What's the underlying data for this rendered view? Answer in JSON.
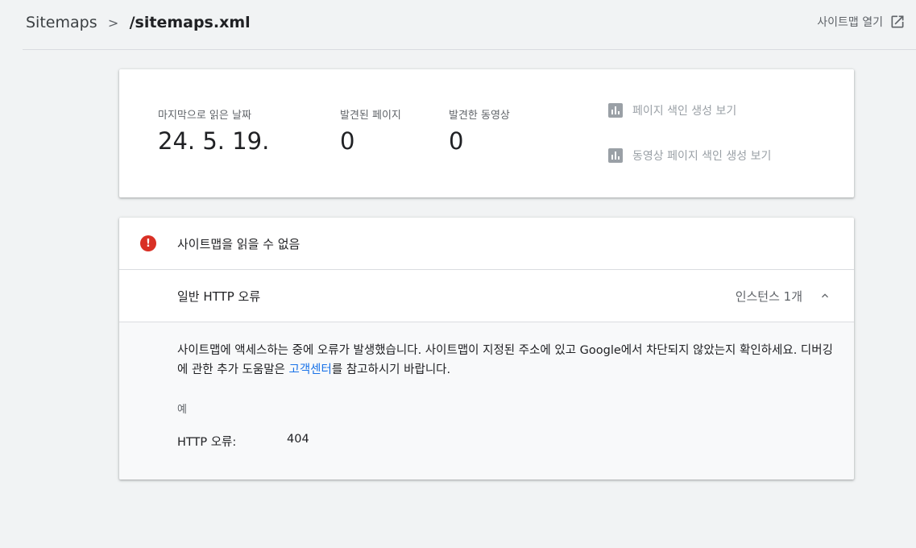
{
  "header": {
    "breadcrumb_root": "Sitemaps",
    "breadcrumb_separator": ">",
    "breadcrumb_current": "/sitemaps.xml",
    "open_sitemap_label": "사이트맵 열기"
  },
  "summary": {
    "last_read_label": "마지막으로 읽은 날짜",
    "last_read_value": "24. 5. 19.",
    "discovered_pages_label": "발견된 페이지",
    "discovered_pages_value": "0",
    "discovered_videos_label": "발견한 동영상",
    "discovered_videos_value": "0",
    "page_index_report_label": "페이지 색인 생성 보기",
    "video_index_report_label": "동영상 페이지 색인 생성 보기"
  },
  "error": {
    "title": "사이트맵을 읽을 수 없음",
    "issue_title": "일반 HTTP 오류",
    "issue_count": "인스턴스 1개",
    "description_before_link": "사이트맵에 액세스하는 중에 오류가 발생했습니다. 사이트맵이 지정된 주소에 있고 Google에서 차단되지 않았는지 확인하세요. 디버깅에 관한 추가 도움말은 ",
    "help_link_text": "고객센터",
    "description_after_link": "를 참고하시기 바랍니다.",
    "example_label": "예",
    "http_error_label": "HTTP 오류:",
    "http_error_value": "404"
  },
  "colors": {
    "error_red": "#d93025",
    "link_blue": "#1a73e8",
    "muted_gray": "#9aa0a6"
  },
  "icons": {
    "open_sitemap": "open-in-new-icon",
    "reports": "bar-chart-icon",
    "error": "error-exclamation-icon",
    "collapse": "chevron-up-icon"
  }
}
